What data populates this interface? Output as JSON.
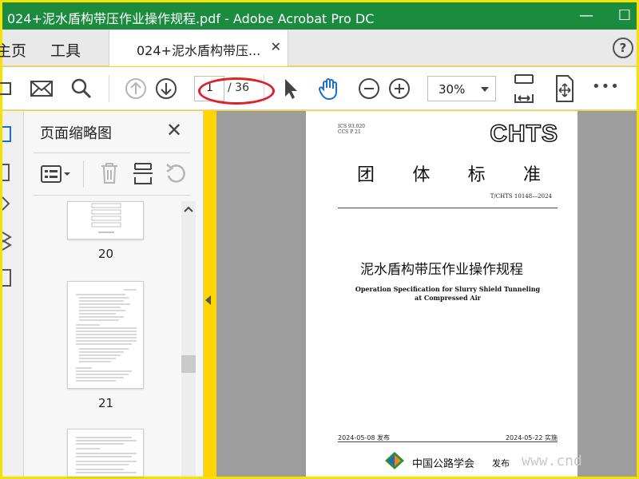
{
  "window": {
    "title": "024+泥水盾构带压作业操作规程.pdf - Adobe Acrobat Pro DC",
    "minimize": "—",
    "maximize": "☐"
  },
  "tabs": {
    "home": "主页",
    "tools": "工具",
    "document": "024+泥水盾构带压...",
    "help": "?"
  },
  "toolbar": {
    "page_current": "1",
    "page_total": "/ 36",
    "zoom": "30%",
    "more": "•••"
  },
  "panel": {
    "title": "页面缩略图",
    "pages": [
      "20",
      "21"
    ]
  },
  "document": {
    "ics": "ICS 93.020",
    "ccs": "CCS P 21",
    "brand": "CHTS",
    "category": [
      "团",
      "体",
      "标",
      "准"
    ],
    "standard_no": "T/CHTS 10148—2024",
    "title_cn": "泥水盾构带压作业操作规程",
    "title_en": "Operation Specification for Slurry Shield Tunneling at Compressed Air",
    "published": "2024-05-08 发布",
    "implemented": "2024-05-22 实施",
    "publisher": "中国公路学会",
    "issue": "发布",
    "watermark": "www.cnd"
  },
  "colors": {
    "titlebar": "#1b8b3f",
    "highlight": "#e0202a",
    "frame": "#ffd400"
  }
}
